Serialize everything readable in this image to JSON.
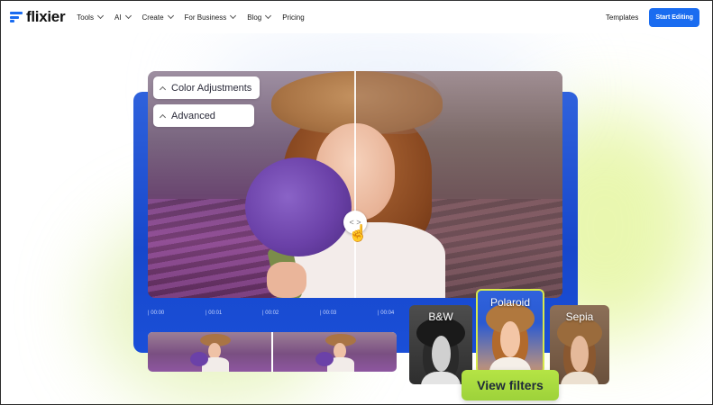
{
  "nav": {
    "logo": "flixier",
    "menu": [
      {
        "label": "Tools",
        "has_dropdown": true
      },
      {
        "label": "AI",
        "has_dropdown": true
      },
      {
        "label": "Create",
        "has_dropdown": true
      },
      {
        "label": "For Business",
        "has_dropdown": true
      },
      {
        "label": "Blog",
        "has_dropdown": true
      },
      {
        "label": "Pricing",
        "has_dropdown": false
      }
    ],
    "templates": "Templates",
    "start_editing": "Start Editing"
  },
  "editor": {
    "panels": [
      "Color Adjustments",
      "Advanced"
    ],
    "timeline_ticks": [
      "| 00:00",
      "| 00:01",
      "| 00:02",
      "| 00:03",
      "| 00:04"
    ],
    "compare_handle": "< >"
  },
  "filters": [
    {
      "label": "B&W"
    },
    {
      "label": "Polaroid"
    },
    {
      "label": "Sepia"
    }
  ],
  "cta": "View filters",
  "colors": {
    "brand_blue": "#1a6cf0",
    "panel_blue": "#1747cb",
    "cta_green": "#9dd23a",
    "selected_outline": "#d8e94a"
  }
}
